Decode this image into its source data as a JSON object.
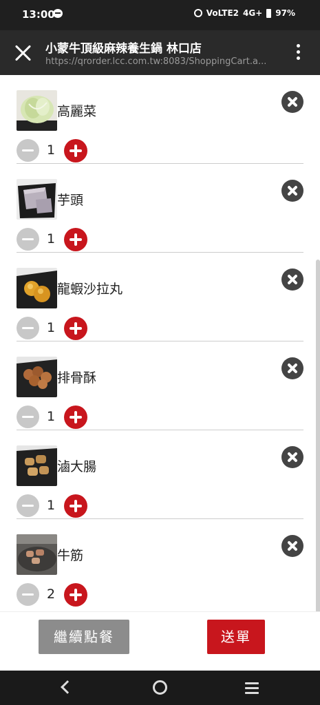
{
  "status_bar": {
    "time": "13:00",
    "signal_text": "4G+",
    "volte_text": "VoLTE2",
    "battery": "97%"
  },
  "app_bar": {
    "title": "小蒙牛頂級麻辣養生鍋 林口店",
    "url": "https://qrorder.lcc.com.tw:8083/ShoppingCart.a...",
    "close_icon": "close-icon",
    "menu_icon": "more-vert-icon"
  },
  "cart": {
    "items": [
      {
        "name": "高麗菜",
        "quantity": "1",
        "image": "cabbage-photo"
      },
      {
        "name": "芋頭",
        "quantity": "1",
        "image": "taro-photo"
      },
      {
        "name": "龍蝦沙拉丸",
        "quantity": "1",
        "image": "lobster-ball-photo"
      },
      {
        "name": "排骨酥",
        "quantity": "1",
        "image": "pork-rib-photo"
      },
      {
        "name": "滷大腸",
        "quantity": "1",
        "image": "intestine-photo"
      },
      {
        "name": "牛筋",
        "quantity": "2",
        "image": "beef-tendon-photo"
      }
    ]
  },
  "footer": {
    "continue_label": "繼續點餐",
    "send_label": "送單"
  },
  "colors": {
    "accent": "#c8161d",
    "secondary_button": "#8c8c8c",
    "app_bar": "#2a2a2a"
  }
}
